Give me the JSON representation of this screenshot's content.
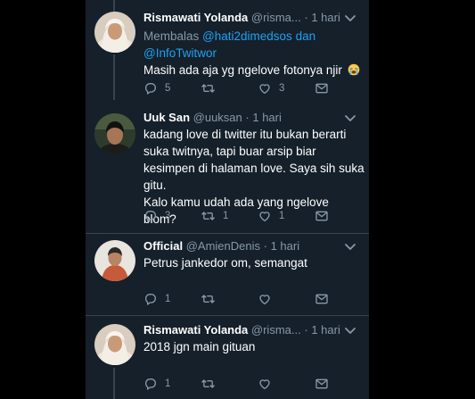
{
  "tweets": [
    {
      "name": "Rismawati Yolanda",
      "handle": "@risma...",
      "time": "1 hari",
      "reply_prefix": "Membalas",
      "reply_user_1": "@hati2dimedsos",
      "reply_and": "dan",
      "reply_user_2": "@InfoTwitwor",
      "text": "Masih ada aja yg ngelove fotonya njir",
      "emoji_icon": "loudly-crying-face-icon",
      "replies": "5",
      "retweets": "",
      "likes": "3"
    },
    {
      "name": "Uuk San",
      "handle": "@uuksan",
      "time": "1 hari",
      "lines": [
        "kadang love di twitter itu bukan berarti",
        "suka twitnya, tapi buar arsip biar",
        "kesimpen di halaman love. Saya sih suka",
        "gitu.",
        "Kalo kamu udah ada yang ngelove blom?"
      ],
      "replies": "3",
      "retweets": "1",
      "likes": "1"
    },
    {
      "name": "Official",
      "handle": "@AmienDenis",
      "time": "1 hari",
      "text": "Petrus jankedor om, semangat",
      "replies": "1",
      "retweets": "",
      "likes": ""
    },
    {
      "name": "Rismawati Yolanda",
      "handle": "@risma...",
      "time": "1 hari",
      "text": "2018 jgn main gituan",
      "replies": "1",
      "retweets": "",
      "likes": ""
    }
  ],
  "separator": "·",
  "colors": {
    "background": "#15202b",
    "outer": "#000000",
    "text": "#ffffff",
    "muted": "#8899a6",
    "link": "#1da1f2",
    "border": "#38444d"
  }
}
